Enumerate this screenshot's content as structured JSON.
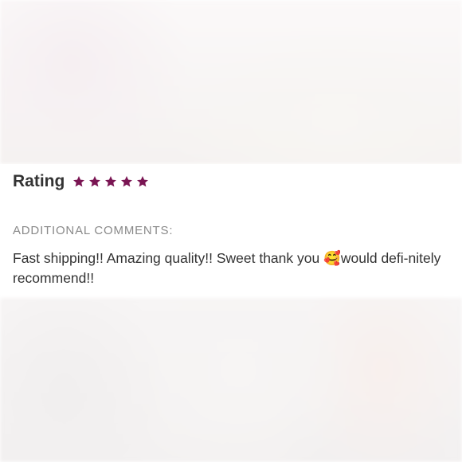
{
  "review": {
    "rating_label": "Rating",
    "rating": 5,
    "rating_max": 5,
    "star_color": "#7a1553",
    "comments_heading": "ADDITIONAL COMMENTS:",
    "comment_text": "Fast shipping!! Amazing quality!! Sweet thank you 🥰would defi-nitely recommend!!"
  }
}
